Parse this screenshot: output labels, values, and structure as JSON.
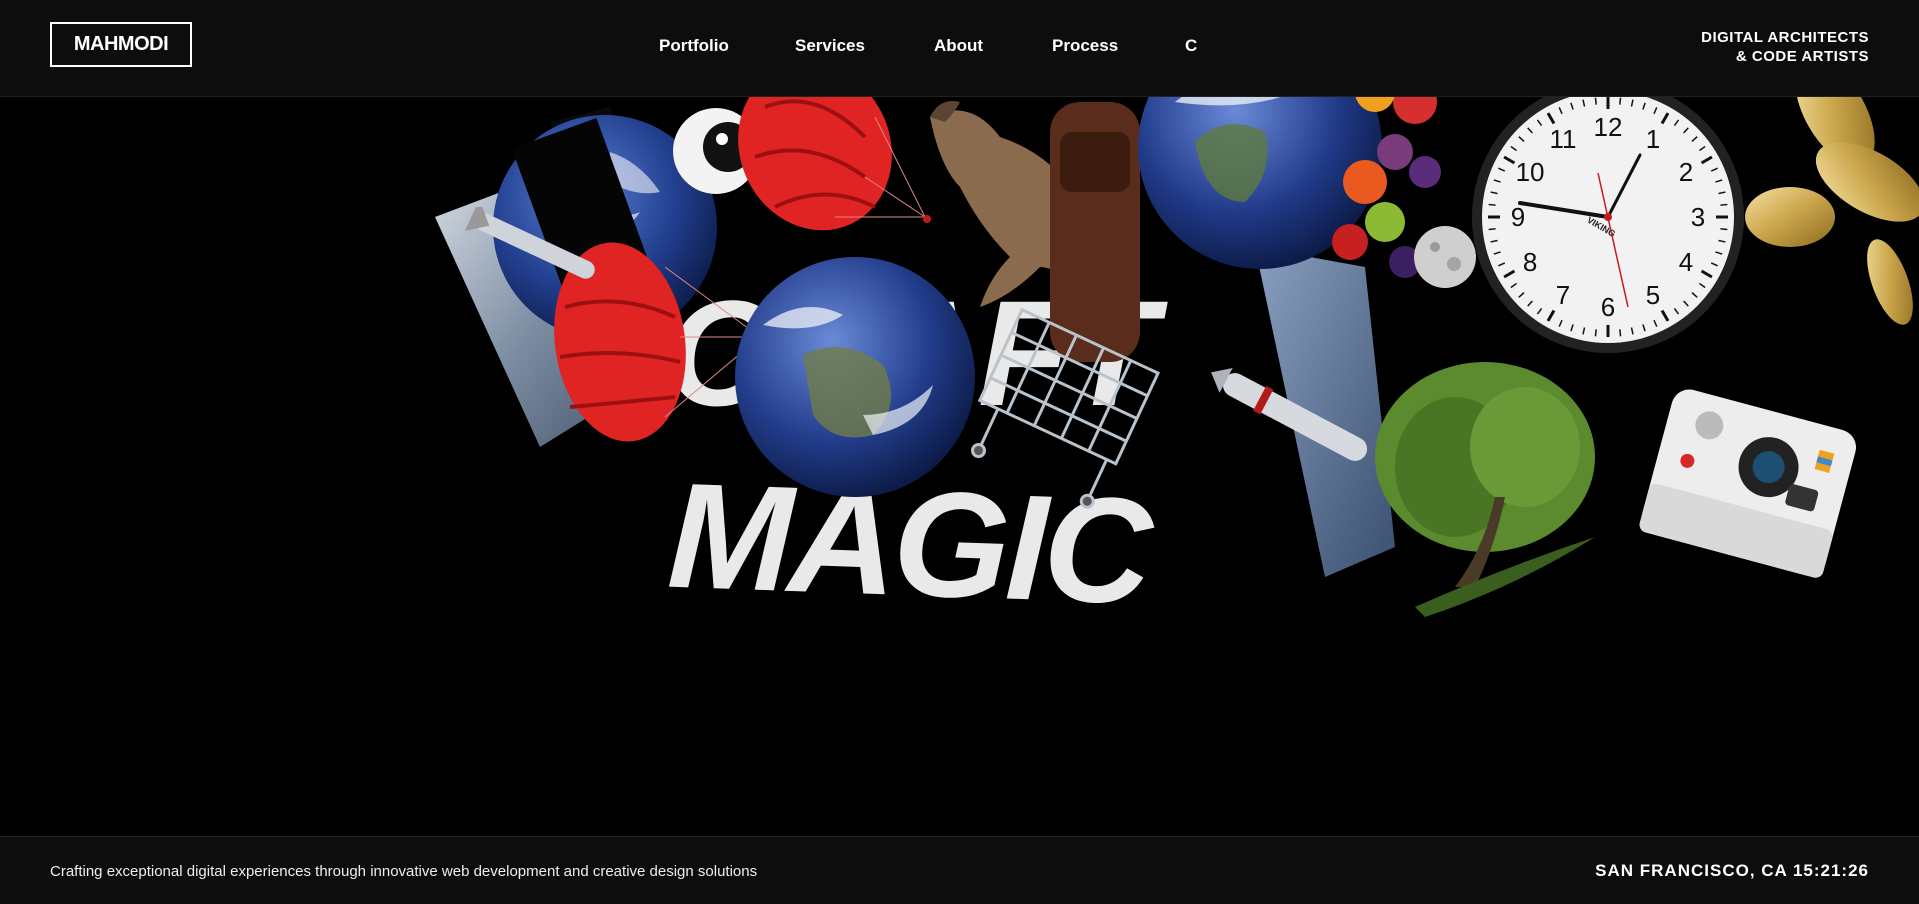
{
  "header": {
    "logo": "MAHMODI",
    "nav": [
      "Portfolio",
      "Services",
      "About",
      "Process",
      "C"
    ],
    "tagline_line1": "DIGITAL ARCHITECTS",
    "tagline_line2": "& CODE ARTISTS"
  },
  "hero": {
    "line1": "CRAFT",
    "line2": "MAGIC",
    "clock_brand": "VIKING",
    "clock_numbers": [
      "12",
      "1",
      "2",
      "3",
      "4",
      "5",
      "6",
      "7",
      "8",
      "9",
      "10",
      "11"
    ]
  },
  "footer": {
    "description": "Crafting exceptional digital experiences through innovative web development and creative design solutions",
    "location": "SAN FRANCISCO, CA",
    "time": "15:21:26"
  },
  "colors": {
    "background": "#000000",
    "bar": "#0d0d0d",
    "text": "#ffffff",
    "parachute": "#e02424",
    "earth": "#2a4aa0"
  }
}
